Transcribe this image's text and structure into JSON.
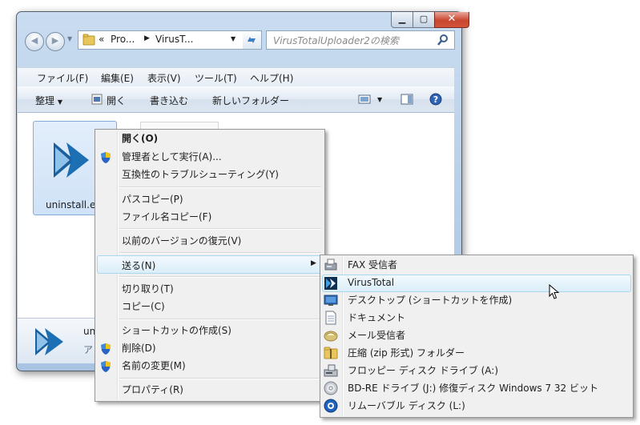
{
  "window": {
    "address": {
      "chevrons": "«",
      "crumbs": [
        "Pro...",
        "VirusT..."
      ]
    },
    "search_placeholder": "VirusTotalUploader2の検索",
    "menubar": [
      "ファイル(F)",
      "編集(E)",
      "表示(V)",
      "ツール(T)",
      "ヘルプ(H)"
    ],
    "toolbar": {
      "organize": "整理",
      "open": "開く",
      "burn": "書き込む",
      "new_folder": "新しいフォルダー"
    },
    "file": {
      "name": "uninstall.e"
    },
    "details": {
      "name": "un",
      "type": "ア"
    }
  },
  "context_menu": {
    "items": [
      {
        "label": "開く(O)",
        "bold": true
      },
      {
        "label": "管理者として実行(A)...",
        "icon": "uac-shield-icon"
      },
      {
        "label": "互換性のトラブルシューティング(Y)"
      },
      {
        "label": "パスコピー(P)"
      },
      {
        "label": "ファイル名コピー(F)"
      },
      {
        "label": "以前のバージョンの復元(V)"
      },
      {
        "label": "送る(N)",
        "submenu": true,
        "highlighted": true
      },
      {
        "label": "切り取り(T)"
      },
      {
        "label": "コピー(C)"
      },
      {
        "label": "ショートカットの作成(S)"
      },
      {
        "label": "削除(D)",
        "icon": "uac-shield-icon"
      },
      {
        "label": "名前の変更(M)",
        "icon": "uac-shield-icon"
      },
      {
        "label": "プロパティ(R)"
      }
    ]
  },
  "send_to_menu": {
    "items": [
      {
        "label": "FAX 受信者",
        "icon": "fax-icon"
      },
      {
        "label": "VirusTotal",
        "icon": "virustotal-icon",
        "highlighted": true
      },
      {
        "label": "デスクトップ (ショートカットを作成)",
        "icon": "desktop-icon"
      },
      {
        "label": "ドキュメント",
        "icon": "document-icon"
      },
      {
        "label": "メール受信者",
        "icon": "mail-icon"
      },
      {
        "label": "圧縮 (zip 形式) フォルダー",
        "icon": "zip-folder-icon"
      },
      {
        "label": "フロッピー ディスク ドライブ (A:)",
        "icon": "floppy-icon"
      },
      {
        "label": "BD-RE ドライブ (J:) 修復ディスク Windows 7 32 ビット",
        "icon": "disc-icon"
      },
      {
        "label": "リムーバブル ディスク (L:)",
        "icon": "removable-disk-icon"
      }
    ]
  },
  "colors": {
    "highlight_border": "#a8d8eb",
    "virustotal_blue": "#1d6fb3",
    "close_red": "#c9452f"
  }
}
